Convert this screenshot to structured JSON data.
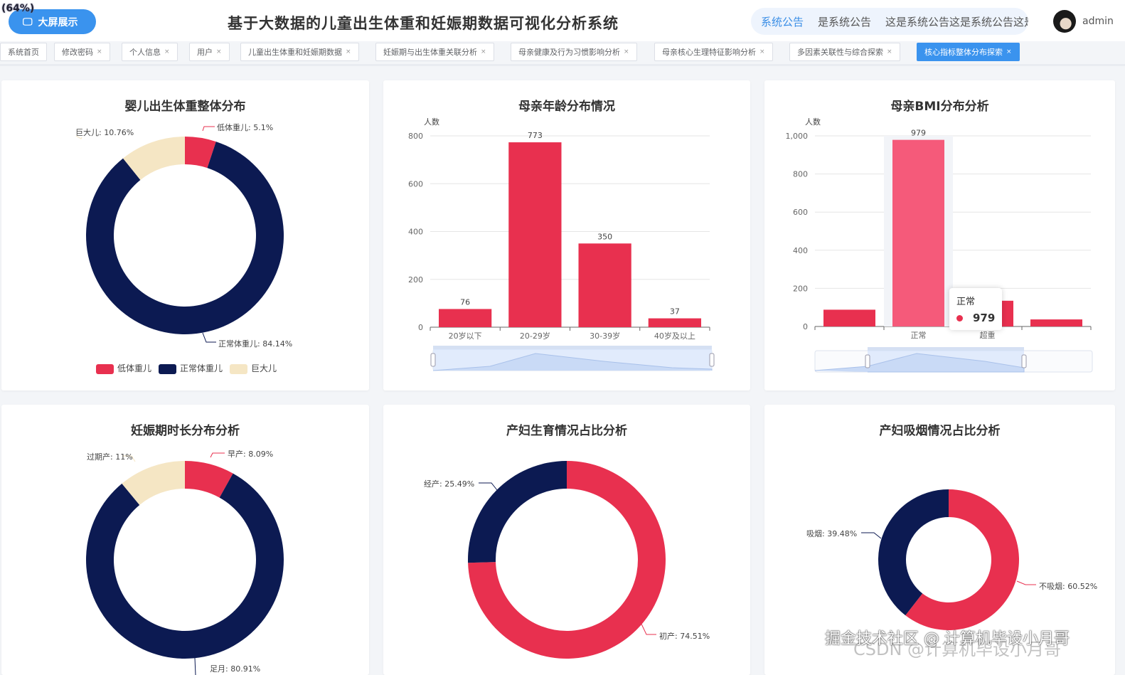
{
  "header": {
    "zoom": "(64%)",
    "big_screen": "大屏展示",
    "title": "基于大数据的儿童出生体重和妊娠期数据可视化分析系统",
    "notice_label": "系统公告",
    "notice_title": "是系统公告",
    "notice_text": "这是系统公告这是系统公告这是",
    "user": "admin"
  },
  "tabs": [
    {
      "label": "系统首页"
    },
    {
      "label": "修改密码"
    },
    {
      "label": "个人信息"
    },
    {
      "label": "用户"
    },
    {
      "label": "儿童出生体重和妊娠期数据"
    },
    {
      "label": "妊娠期与出生体重关联分析"
    },
    {
      "label": "母亲健康及行为习惯影响分析"
    },
    {
      "label": "母亲核心生理特征影响分析"
    },
    {
      "label": "多因素关联性与综合探索"
    },
    {
      "label": "核心指标整体分布探索",
      "active": true
    }
  ],
  "colors": {
    "red": "#e8304f",
    "navy": "#0c1a52",
    "beige": "#f5e6c4",
    "highlight": "#f55a7a"
  },
  "chart_data": [
    {
      "type": "pie",
      "title": "婴儿出生体重整体分布",
      "slices": [
        {
          "name": "低体重儿",
          "value": 5.1,
          "label": "低体重儿: 5.1%"
        },
        {
          "name": "正常体重儿",
          "value": 84.14,
          "label": "正常体重儿: 84.14%"
        },
        {
          "name": "巨大儿",
          "value": 10.76,
          "label": "巨大儿: 10.76%"
        }
      ],
      "legend": [
        "低体重儿",
        "正常体重儿",
        "巨大儿"
      ]
    },
    {
      "type": "bar",
      "title": "母亲年龄分布情况",
      "ylabel": "人数",
      "ylim": [
        0,
        800
      ],
      "yticks": [
        "0",
        "200",
        "400",
        "600",
        "800"
      ],
      "categories": [
        "20岁以下",
        "20-29岁",
        "30-39岁",
        "40岁及以上"
      ],
      "values": [
        76,
        773,
        350,
        37
      ]
    },
    {
      "type": "bar",
      "title": "母亲BMI分布分析",
      "ylabel": "人数",
      "ylim": [
        0,
        1000
      ],
      "yticks": [
        "0",
        "200",
        "400",
        "600",
        "800",
        "1,000"
      ],
      "categories": [
        "",
        "正常",
        "超重",
        ""
      ],
      "values": [
        88,
        979,
        135,
        37
      ],
      "value_label": "979",
      "tooltip": {
        "name": "正常",
        "value": "979"
      }
    },
    {
      "type": "pie",
      "title": "妊娠期时长分布分析",
      "slices": [
        {
          "name": "早产",
          "value": 8.09,
          "label": "早产: 8.09%"
        },
        {
          "name": "足月",
          "value": 80.91,
          "label": "足月: 80.91%"
        },
        {
          "name": "过期产",
          "value": 11,
          "label": "过期产: 11%"
        }
      ]
    },
    {
      "type": "pie",
      "title": "产妇生育情况占比分析",
      "slices": [
        {
          "name": "初产",
          "value": 74.51,
          "label": "初产: 74.51%"
        },
        {
          "name": "经产",
          "value": 25.49,
          "label": "经产: 25.49%"
        }
      ]
    },
    {
      "type": "pie",
      "title": "产妇吸烟情况占比分析",
      "slices": [
        {
          "name": "不吸烟",
          "value": 60.52,
          "label": "不吸烟: 60.52%"
        },
        {
          "name": "吸烟",
          "value": 39.48,
          "label": "吸烟: 39.48%"
        }
      ]
    }
  ],
  "watermark": {
    "juejin": "掘金技术社区 @ 计算机毕设小月哥",
    "csdn": "CSDN @计算机毕设小月哥"
  }
}
